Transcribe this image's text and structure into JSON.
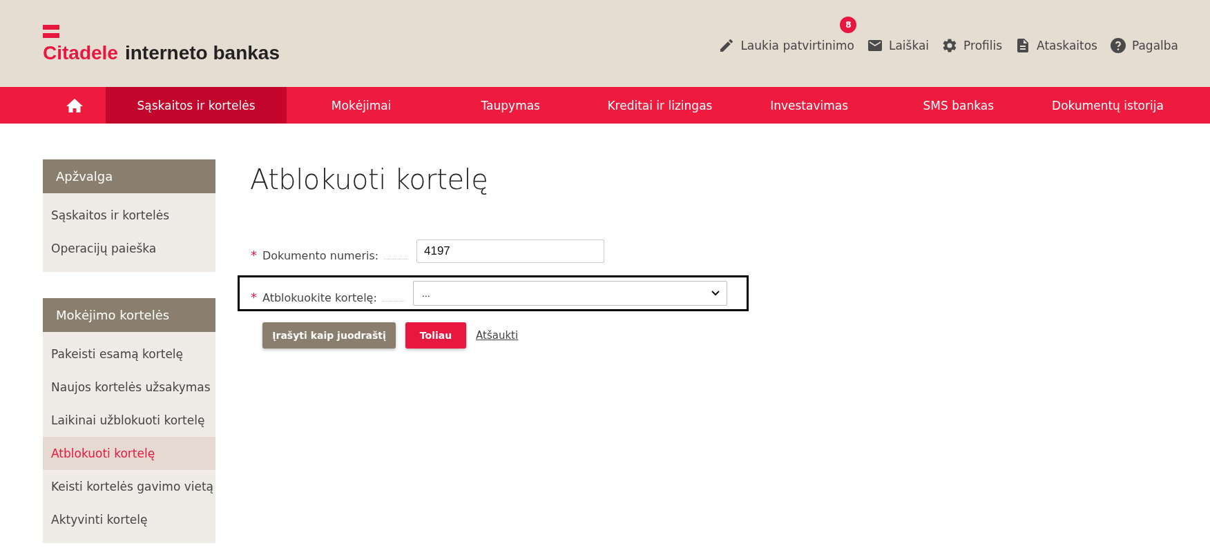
{
  "header": {
    "logo": {
      "brand": "Citadele",
      "product": "interneto bankas"
    },
    "links": [
      {
        "kind": "pencil",
        "label": "Laukia patvirtinimo",
        "badge": "8"
      },
      {
        "kind": "mail",
        "label": "Laiškai"
      },
      {
        "kind": "gear",
        "label": "Profilis"
      },
      {
        "kind": "document",
        "label": "Ataskaitos"
      },
      {
        "kind": "help",
        "label": "Pagalba"
      }
    ]
  },
  "nav": {
    "home_selected": false,
    "items": [
      {
        "label": "Sąskaitos ir kortelės",
        "selected": true
      },
      {
        "label": "Mokėjimai",
        "selected": false
      },
      {
        "label": "Taupymas",
        "selected": false
      },
      {
        "label": "Kreditai ir lizingas",
        "selected": false
      },
      {
        "label": "Investavimas",
        "selected": false
      },
      {
        "label": "SMS bankas",
        "selected": false
      },
      {
        "label": "Dokumentų istorija",
        "selected": false
      }
    ]
  },
  "sidebar": [
    {
      "title": "Apžvalga",
      "items": [
        {
          "label": "Sąskaitos ir kortelės",
          "selected": false
        },
        {
          "label": "Operacijų paieška",
          "selected": false
        }
      ]
    },
    {
      "title": "Mokėjimo kortelės",
      "items": [
        {
          "label": "Pakeisti esamą kortelę",
          "selected": false
        },
        {
          "label": "Naujos kortelės užsakymas",
          "selected": false
        },
        {
          "label": "Laikinai užblokuoti kortelę",
          "selected": false
        },
        {
          "label": "Atblokuoti kortelę",
          "selected": true
        },
        {
          "label": "Keisti kortelės gavimo vietą",
          "selected": false
        },
        {
          "label": "Aktyvinti kortelę",
          "selected": false
        }
      ]
    }
  ],
  "page_title": "Atblokuoti kortelę",
  "form": {
    "fields": [
      {
        "kind": "input",
        "required_mark": "*",
        "highlighted": false,
        "label": "Dokumento numeris:",
        "value": "4197"
      },
      {
        "kind": "select",
        "required_mark": "*",
        "highlighted": true,
        "label": "Atblokuokite kortelę:",
        "value": "..."
      }
    ],
    "buttons": [
      {
        "kind": "secondary",
        "label": "Įrašyti kaip juodraštį"
      },
      {
        "kind": "primary",
        "label": "Toliau"
      },
      {
        "kind": "link",
        "label": "Atšaukti"
      }
    ]
  }
}
